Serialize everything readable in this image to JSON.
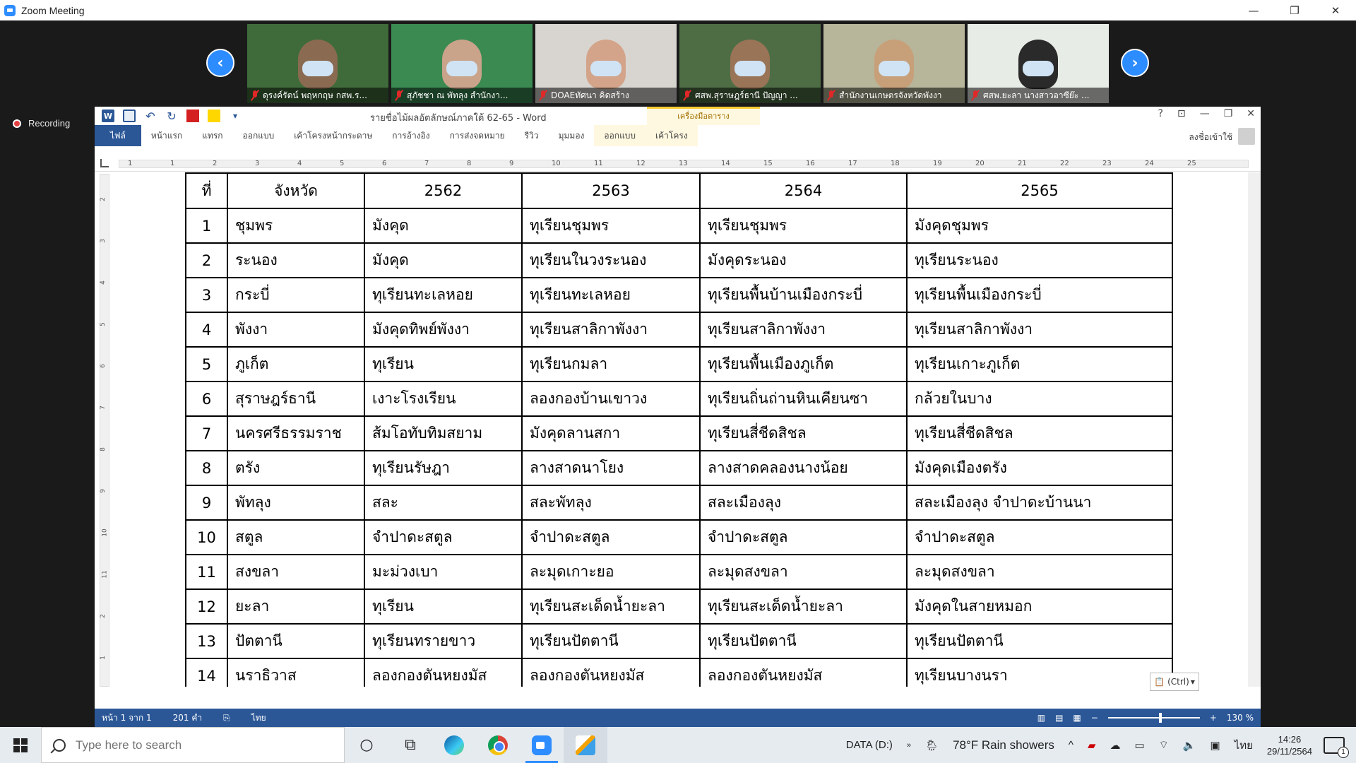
{
  "zoom": {
    "window_title": "Zoom Meeting",
    "recording_label": "Recording",
    "participants": [
      {
        "name": "ดุรงค์รัตน์ พฤหกฤษ กสพ.ร...",
        "bg": "#3f6b3a",
        "face": "#8a6a50"
      },
      {
        "name": "สุภัชชา ณ พัทลุง สำนักงา...",
        "bg": "#3b8a52",
        "face": "#c9a38a"
      },
      {
        "name": "DOAEทัศนา คิดสร้าง",
        "bg": "#d8d5d0",
        "face": "#d3a48a"
      },
      {
        "name": "ศสพ.สุราษฎร์ธานี ปัญญา ...",
        "bg": "#4e6d45",
        "face": "#9a7457"
      },
      {
        "name": "สำนักงานเกษตรจังหวัดพังงา",
        "bg": "#b7b59a",
        "face": "#c7a07a"
      },
      {
        "name": "ศสพ.ยะลา นางสาวอาซีย๊ะ ...",
        "bg": "#e8ece6",
        "face": "#2a2a2a"
      }
    ]
  },
  "word": {
    "doc_title": "รายชื่อไม้ผลอัตลักษณ์ภาคใต้ 62-65 - Word",
    "tool_group_label": "เครื่องมือตาราง",
    "tabs": [
      "ไฟล์",
      "หน้าแรก",
      "แทรก",
      "ออกแบบ",
      "เค้าโครงหน้ากระดาษ",
      "การอ้างอิง",
      "การส่งจดหมาย",
      "รีวิว",
      "มุมมอง",
      "ออกแบบ",
      "เค้าโครง"
    ],
    "signin": "ลงชื่อเข้าใช้",
    "ruler_numbers": [
      "1",
      "1",
      "2",
      "3",
      "4",
      "5",
      "6",
      "7",
      "8",
      "9",
      "10",
      "11",
      "12",
      "13",
      "14",
      "15",
      "16",
      "17",
      "18",
      "19",
      "20",
      "21",
      "22",
      "23",
      "24",
      "25"
    ],
    "vruler_numbers": [
      "2",
      "3",
      "4",
      "5",
      "6",
      "7",
      "8",
      "9",
      "10",
      "11",
      "2",
      "1"
    ],
    "paste_options": "(Ctrl)",
    "status": {
      "page": "หน้า 1 จาก 1",
      "words": "201 คำ",
      "lang": "ไทย",
      "zoom": "130 %"
    }
  },
  "table": {
    "headers": [
      "ที่",
      "จังหวัด",
      "2562",
      "2563",
      "2564",
      "2565"
    ],
    "rows": [
      [
        "1",
        "ชุมพร",
        "มังคุด",
        "ทุเรียนชุมพร",
        "ทุเรียนชุมพร",
        "มังคุดชุมพร"
      ],
      [
        "2",
        "ระนอง",
        "มังคุด",
        "ทุเรียนในวงระนอง",
        "มังคุดระนอง",
        "ทุเรียนระนอง"
      ],
      [
        "3",
        "กระบี่",
        "ทุเรียนทะเลหอย",
        "ทุเรียนทะเลหอย",
        "ทุเรียนพื้นบ้านเมืองกระบี่",
        "ทุเรียนพื้นเมืองกระบี่"
      ],
      [
        "4",
        "พังงา",
        "มังคุดทิพย์พังงา",
        "ทุเรียนสาลิกาพังงา",
        "ทุเรียนสาลิกาพังงา",
        "ทุเรียนสาลิกาพังงา"
      ],
      [
        "5",
        "ภูเก็ต",
        "ทุเรียน",
        "ทุเรียนกมลา",
        "ทุเรียนพื้นเมืองภูเก็ต",
        "ทุเรียนเกาะภูเก็ต"
      ],
      [
        "6",
        "สุราษฎร์ธานี",
        "เงาะโรงเรียน",
        "ลองกองบ้านเขาวง",
        "ทุเรียนถิ่นถ่านหินเคียนซา",
        "กล้วยในบาง"
      ],
      [
        "7",
        "นครศรีธรรมราช",
        "ส้มโอทับทิมสยาม",
        "มังคุดลานสกา",
        "ทุเรียนสี่ชีดสิชล",
        "ทุเรียนสี่ชีดสิชล"
      ],
      [
        "8",
        "ตรัง",
        "ทุเรียนรัษฎา",
        "ลางสาดนาโยง",
        "ลางสาดคลองนางน้อย",
        "มังคุดเมืองตรัง"
      ],
      [
        "9",
        "พัทลุง",
        "สละ",
        "สละพัทลุง",
        "สละเมืองลุง",
        "สละเมืองลุง จำปาดะบ้านนา"
      ],
      [
        "10",
        "สตูล",
        "จำปาดะสตูล",
        "จำปาดะสตูล",
        "จำปาดะสตูล",
        "จำปาดะสตูล"
      ],
      [
        "11",
        "สงขลา",
        "มะม่วงเบา",
        "ละมุดเกาะยอ",
        "ละมุดสงขลา",
        "ละมุดสงขลา"
      ],
      [
        "12",
        "ยะลา",
        "ทุเรียน",
        "ทุเรียนสะเด็ดน้ำยะลา",
        "ทุเรียนสะเด็ดน้ำยะลา",
        "มังคุดในสายหมอก"
      ],
      [
        "13",
        "ปัตตานี",
        "ทุเรียนทรายขาว",
        "ทุเรียนปัตตานี",
        "ทุเรียนปัตตานี",
        "ทุเรียนปัตตานี"
      ],
      [
        "14",
        "นราธิวาส",
        "ลองกองตันหยงมัส",
        "ลองกองตันหยงมัส",
        "ลองกองตันหยงมัส",
        "ทุเรียนบางนรา"
      ]
    ]
  },
  "taskbar": {
    "search_placeholder": "Type here to search",
    "drive": "DATA (D:)",
    "weather": "78°F  Rain showers",
    "ime": "ไทย",
    "time": "14:26",
    "date": "29/11/2564",
    "notif_count": "1"
  }
}
